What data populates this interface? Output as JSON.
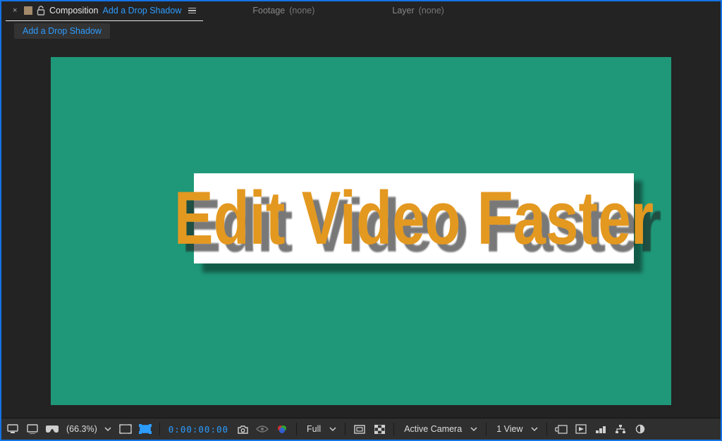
{
  "tabs": {
    "composition": {
      "label": "Composition",
      "comp_name": "Add a Drop Shadow"
    },
    "footage": {
      "label": "Footage",
      "value": "(none)"
    },
    "layer": {
      "label": "Layer",
      "value": "(none)"
    }
  },
  "breadcrumb": {
    "label": "Add a Drop Shadow"
  },
  "canvas": {
    "main_text": "Edit Video Faster"
  },
  "toolbar": {
    "zoom": "(66.3%)",
    "timecode": "0:00:00:00",
    "resolution": "Full",
    "camera": "Active Camera",
    "views": "1 View"
  }
}
